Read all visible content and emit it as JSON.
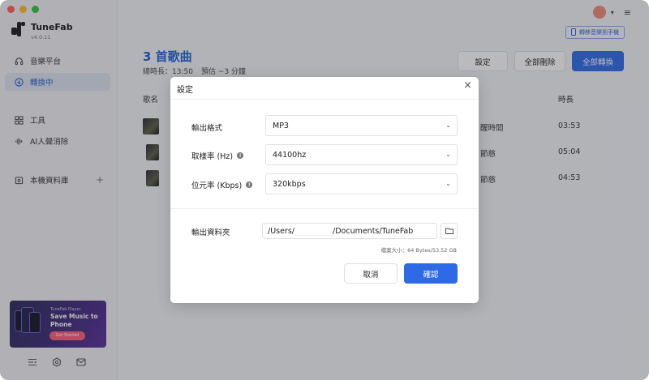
{
  "sidebar": {
    "app_name": "TuneFab",
    "version": "v4.0.11",
    "nav": [
      {
        "label": "音樂平台",
        "icon": "headphones-icon"
      },
      {
        "label": "轉換中",
        "icon": "download-icon"
      },
      {
        "label": "工具",
        "icon": "grid-icon"
      },
      {
        "label": "AI人聲消除",
        "icon": "waveform-icon"
      },
      {
        "label": "本機資料庫",
        "icon": "library-icon"
      }
    ],
    "promo": {
      "small": "TuneFab Player",
      "title_line1": "Save Music to",
      "title_line2": "Phone",
      "button": "Get Started"
    }
  },
  "header": {
    "transfer_label": "轉移音樂到手機",
    "song_count": "3 首歌曲",
    "total_duration": "總時長：13:50",
    "estimate": "預估 ~3 分鐘",
    "settings_button": "設定",
    "delete_all_button": "全部刪除",
    "convert_all_button": "全部轉換"
  },
  "table": {
    "col_title": "歌名",
    "col_duration": "時長",
    "rows": [
      {
        "extra": "醒時間",
        "duration": "03:53"
      },
      {
        "extra": "節慈",
        "duration": "05:04"
      },
      {
        "extra": "節慈",
        "duration": "04:53"
      }
    ]
  },
  "dialog": {
    "title": "設定",
    "output_format_label": "輸出格式",
    "output_format_value": "MP3",
    "sample_rate_label": "取樣率 (Hz)",
    "sample_rate_value": "44100hz",
    "bitrate_label": "位元率 (Kbps)",
    "bitrate_value": "320kbps",
    "output_folder_label": "輸出資料夾",
    "path_prefix": "/Users/",
    "path_suffix": "/Documents/TuneFab",
    "file_size": "檔案大小：64 Bytes/53.52 GB",
    "cancel_button": "取消",
    "confirm_button": "確認"
  },
  "colors": {
    "accent": "#2e6ae6",
    "title_blue": "#1e5fd6",
    "overlay": "rgba(40,40,50,0.32)"
  }
}
